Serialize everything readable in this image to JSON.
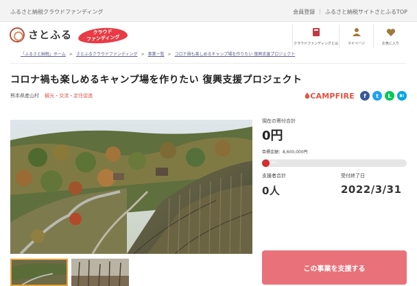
{
  "topbar": {
    "site_label": "ふるさと納税クラウドファンディング",
    "links": [
      "会員登録",
      "ふるさと納税サイトさとふるTOP"
    ]
  },
  "header": {
    "logo_text": "さとふる",
    "badge_line1": "クラウド",
    "badge_line2": "ファンディング",
    "icons": [
      {
        "icon": "book-icon",
        "label": "クラウドファンディングとは"
      },
      {
        "icon": "person-icon",
        "label": "マイページ"
      },
      {
        "icon": "heart-icon",
        "label": "お気に入り"
      }
    ]
  },
  "breadcrumb": [
    "「ふるさと納税」ホーム",
    "さとふるクラウドファンディング",
    "事業一覧",
    "コロナ禍も楽しめるキャンプ場を作りたい 復興支援プロジェクト"
  ],
  "project": {
    "title": "コロナ禍も楽しめるキャンプ場を作りたい 復興支援プロジェクト",
    "municipality": "熊本県産山村",
    "tags": "観光・交流・定住促進"
  },
  "share": {
    "campfire": "CAMPFIRE",
    "buttons": [
      {
        "icon": "facebook-icon",
        "glyph": "f",
        "color": "#3b5998"
      },
      {
        "icon": "twitter-icon",
        "glyph": "t",
        "color": "#1da1f2"
      },
      {
        "icon": "line-icon",
        "glyph": "L",
        "color": "#06c755"
      },
      {
        "icon": "hatena-icon",
        "glyph": "B!",
        "color": "#00a4de"
      }
    ]
  },
  "funding": {
    "current_label": "現在の寄付合計",
    "current_value": "0円",
    "goal": "目標金額：8,600,000円",
    "progress_percent": 0,
    "progress_label": "0%",
    "supporters_label": "支援者合計",
    "supporters_value": "0人",
    "deadline_label": "受付終了日",
    "deadline_value": "2022/3/31"
  },
  "support_button": "この事業を支援する",
  "colors": {
    "accent": "#e83b45",
    "button": "#e9727a",
    "progress": "#d32f2f"
  }
}
